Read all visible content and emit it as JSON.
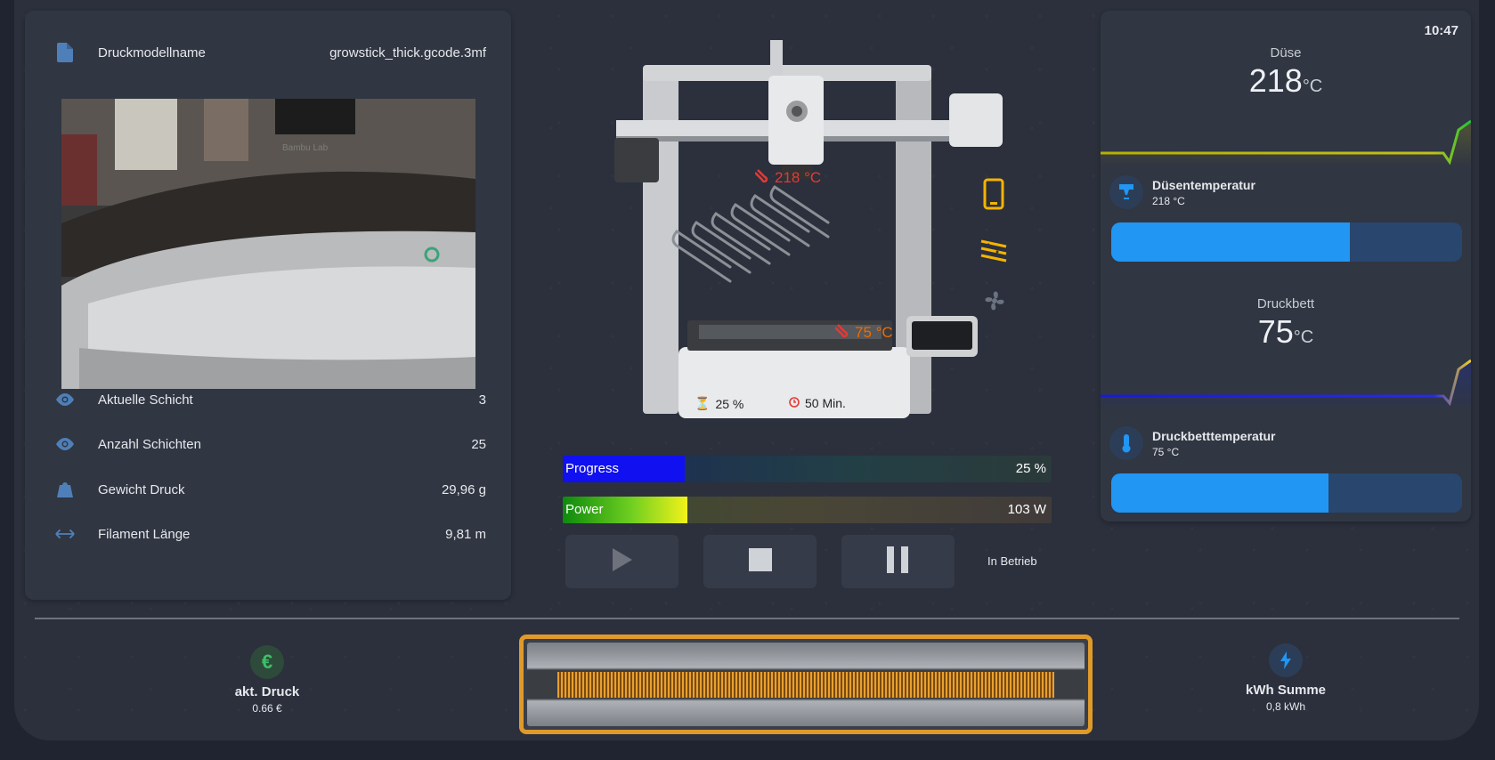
{
  "left": {
    "model_label": "Druckmodellname",
    "model_value": "growstick_thick.gcode.3mf",
    "camera_overlay_brand": "Bambu Lab",
    "rows": [
      {
        "label": "Aktuelle Schicht",
        "value": "3"
      },
      {
        "label": "Anzahl Schichten",
        "value": "25"
      },
      {
        "label": "Gewicht Druck",
        "value": "29,96 g"
      },
      {
        "label": "Filament Länge",
        "value": "9,81 m"
      }
    ],
    "icons": [
      "file-icon",
      "eye-icon",
      "eye-icon",
      "weight-icon",
      "arrows-horizontal-icon"
    ]
  },
  "printer": {
    "nozzle_temp": "218 °C",
    "bed_temp": "75 °C",
    "progress_small": "25 %",
    "time_remaining": "50 Min.",
    "side_icons": [
      "phone-icon",
      "bed-heating-icon",
      "fan-icon"
    ],
    "colors": {
      "nozzle_temp": "#e53935",
      "bed_temp": "#ef6c00",
      "side_icon": "#f5b301",
      "fan_icon": "#6b7280"
    }
  },
  "bars": {
    "progress_label": "Progress",
    "progress_value": "25 %",
    "progress_fraction": 0.25,
    "power_label": "Power",
    "power_value": "103 W",
    "power_fraction": 0.255
  },
  "controls": {
    "status": "In Betrieb",
    "buttons": [
      "play-icon",
      "stop-icon",
      "pause-icon"
    ]
  },
  "right": {
    "time": "10:47",
    "nozzle": {
      "name": "Düse",
      "value": "218",
      "unit": "°C"
    },
    "nozzle_entity": {
      "name": "Düsentemperatur",
      "value": "218 °C",
      "fraction": 0.68
    },
    "bed": {
      "name": "Druckbett",
      "value": "75",
      "unit": "°C"
    },
    "bed_entity": {
      "name": "Druckbetttemperatur",
      "value": "75 °C",
      "fraction": 0.62
    }
  },
  "bottom": {
    "cost_label": "akt. Druck",
    "cost_value": "0.66 €",
    "cost_icon": "euro-icon",
    "energy_label": "kWh Summe",
    "energy_value": "0,8 kWh",
    "energy_icon": "lightning-icon",
    "filament_preview_color": "#e8a030"
  }
}
